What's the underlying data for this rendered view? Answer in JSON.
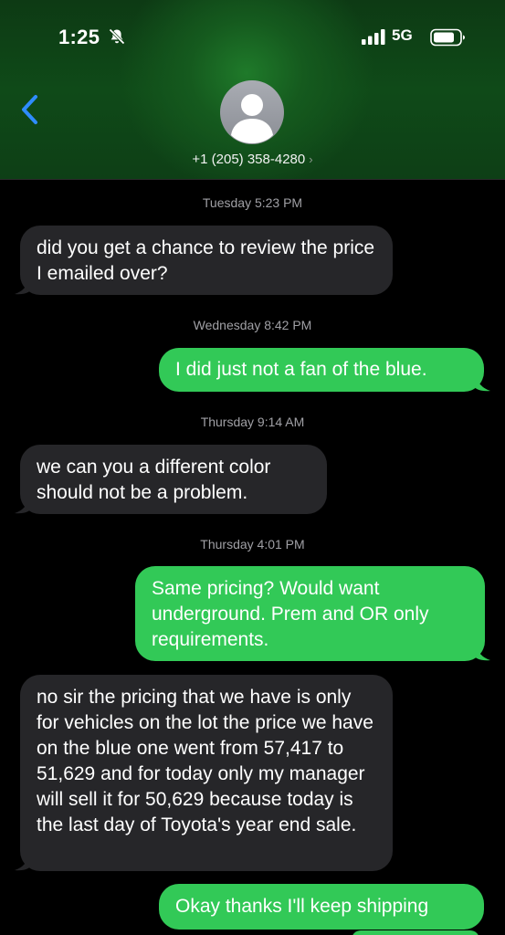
{
  "status_bar": {
    "time": "1:25",
    "network": "5G"
  },
  "header": {
    "contact": "+1 (205) 358-4280",
    "chevron": "›"
  },
  "thread": {
    "timestamps": [
      {
        "day": "Tuesday",
        "time": "5:23 PM",
        "label": "Tuesday 5:23 PM"
      },
      {
        "day": "Wednesday",
        "time": "8:42 PM",
        "label": "Wednesday 8:42 PM"
      },
      {
        "day": "Thursday",
        "time": "9:14 AM",
        "label": "Thursday 9:14 AM"
      },
      {
        "day": "Thursday",
        "time": "4:01 PM",
        "label": "Thursday 4:01 PM"
      }
    ],
    "messages": [
      {
        "direction": "incoming",
        "text": "did you get a chance to review the price I emailed over?"
      },
      {
        "direction": "outgoing",
        "text": "I did just not a fan of the blue."
      },
      {
        "direction": "incoming",
        "text": "we can you a different color should not be a problem."
      },
      {
        "direction": "outgoing",
        "text": "Same pricing? Would want underground. Prem and OR only requirements."
      },
      {
        "direction": "incoming",
        "text": "no sir the pricing that  we have is only for vehicles on the lot the price we have on the blue one went from 57,417 to 51,629 and for today only my manager will sell it for 50,629 because today is the last day of Toyota's year end sale."
      },
      {
        "direction": "outgoing",
        "text": "Okay thanks I'll keep shipping"
      }
    ]
  },
  "colors": {
    "incoming_bubble": "#262629",
    "outgoing_bubble": "#32c957",
    "header_green": "#0f4a18",
    "back_blue": "#2f8cff"
  },
  "icons": [
    "bell-slash-icon",
    "signal-bars-icon",
    "battery-icon",
    "back-chevron-icon",
    "person-avatar-icon"
  ]
}
